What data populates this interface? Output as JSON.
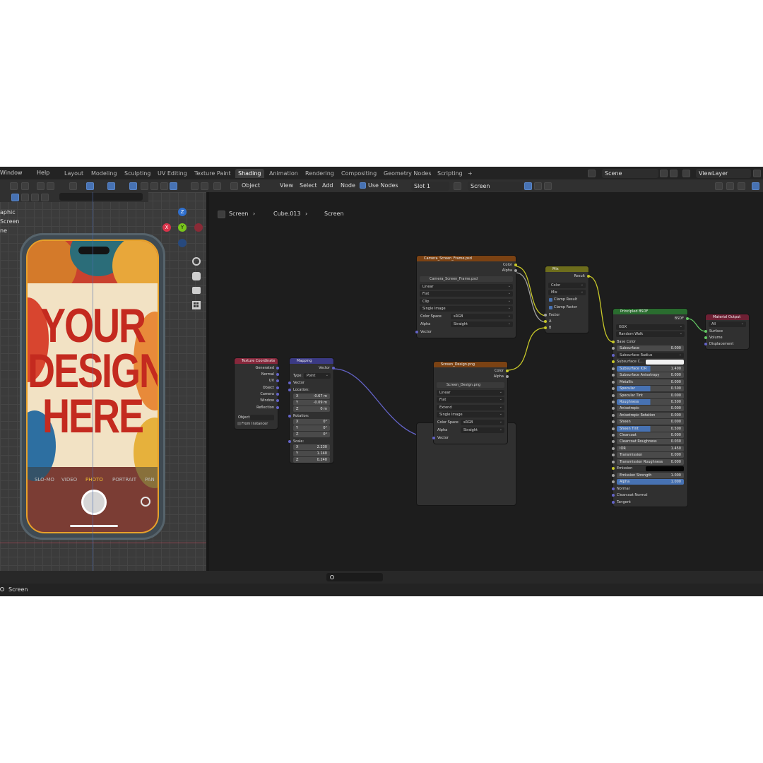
{
  "menubar": {
    "menus": [
      "Window",
      "Help"
    ],
    "workspaces": [
      "Layout",
      "Modeling",
      "Sculpting",
      "UV Editing",
      "Texture Paint",
      "Shading",
      "Animation",
      "Rendering",
      "Compositing",
      "Geometry Nodes",
      "Scripting"
    ],
    "add_tab": "+",
    "scene": "Scene",
    "view_layer": "ViewLayer"
  },
  "node_header": {
    "mode": "Object",
    "menus": [
      "View",
      "Select",
      "Add",
      "Node"
    ],
    "use_nodes": "Use Nodes",
    "slot": "Slot 1",
    "material": "Screen"
  },
  "breadcrumb": [
    "Screen",
    "Cube.013",
    "Screen"
  ],
  "outliner_fragment": [
    "aphic",
    "Screen",
    "ne"
  ],
  "viewport": {
    "axis": {
      "z": "Z",
      "x": "X",
      "y": "Y"
    },
    "design_text": [
      "YOUR",
      "DESIGN",
      "HERE"
    ],
    "camera_modes": [
      "SLO-MO",
      "VIDEO",
      "PHOTO",
      "PORTRAIT",
      "PAN"
    ]
  },
  "nodes": {
    "camera_frame": {
      "title": "Camera_Screen_Frame.psd",
      "outputs": [
        "Color",
        "Alpha"
      ],
      "image": "Camera_Screen_Frame.psd",
      "interp": "Linear",
      "proj": "Flat",
      "ext": "Clip",
      "source": "Single Image",
      "cs_label": "Color Space",
      "cs": "sRGB",
      "alpha_label": "Alpha",
      "alpha": "Straight",
      "input": "Vector"
    },
    "screen_design": {
      "title": "Screen_Design.png",
      "outputs": [
        "Color",
        "Alpha"
      ],
      "image": "Screen_Design.png",
      "interp": "Linear",
      "proj": "Flat",
      "ext": "Extend",
      "source": "Single Image",
      "cs_label": "Color Space",
      "cs": "sRGB",
      "alpha_label": "Alpha",
      "alpha": "Straight",
      "input": "Vector"
    },
    "mix": {
      "title": "Mix",
      "output": "Result",
      "type": "Color",
      "blend": "Mix",
      "clamp_result": "Clamp Result",
      "clamp_factor": "Clamp Factor",
      "inputs": [
        "Factor",
        "A",
        "B"
      ]
    },
    "texcoord": {
      "title": "Texture Coordinate",
      "outputs": [
        "Generated",
        "Normal",
        "UV",
        "Object",
        "Camera",
        "Window",
        "Reflection"
      ],
      "object_label": "Object:",
      "from_instancer": "From Instancer"
    },
    "mapping": {
      "title": "Mapping",
      "output": "Vector",
      "type_label": "Type:",
      "type": "Point",
      "input": "Vector",
      "location_label": "Location:",
      "location": [
        [
          "X",
          "-0.67 m"
        ],
        [
          "Y",
          "-0.09 m"
        ],
        [
          "Z",
          "0 m"
        ]
      ],
      "rotation_label": "Rotation:",
      "rotation": [
        [
          "X",
          "0°"
        ],
        [
          "Y",
          "0°"
        ],
        [
          "Z",
          "0°"
        ]
      ],
      "scale_label": "Scale:",
      "scale": [
        [
          "X",
          "2.230"
        ],
        [
          "Y",
          "1.140"
        ],
        [
          "Z",
          "0.240"
        ]
      ]
    },
    "bsdf": {
      "title": "Principled BSDF",
      "output": "BSDF",
      "distribution": "GGX",
      "sss_method": "Random Walk",
      "base_color": "Base Color",
      "subsurface": [
        "Subsurface",
        "0.000"
      ],
      "subsurface_radius": "Subsurface Radius",
      "subsurface_color": "Subsurface C...",
      "params": [
        [
          "Subsurface IOR",
          "1.400",
          "half"
        ],
        [
          "Subsurface Anisotropy",
          "0.000",
          "none"
        ],
        [
          "Metallic",
          "0.000",
          "none"
        ],
        [
          "Specular",
          "0.500",
          "half"
        ],
        [
          "Specular Tint",
          "0.000",
          "none"
        ],
        [
          "Roughness",
          "0.500",
          "half"
        ],
        [
          "Anisotropic",
          "0.000",
          "none"
        ],
        [
          "Anisotropic Rotation",
          "0.000",
          "none"
        ],
        [
          "Sheen",
          "0.000",
          "none"
        ],
        [
          "Sheen Tint",
          "0.500",
          "half"
        ],
        [
          "Clearcoat",
          "0.000",
          "none"
        ],
        [
          "Clearcoat Roughness",
          "0.030",
          "none"
        ],
        [
          "IOR",
          "1.450",
          "none"
        ],
        [
          "Transmission",
          "0.000",
          "none"
        ],
        [
          "Transmission Roughness",
          "0.000",
          "none"
        ]
      ],
      "emission": "Emission",
      "emission_strength": [
        "Emission Strength",
        "1.000"
      ],
      "alpha": [
        "Alpha",
        "1.000"
      ],
      "tail": [
        "Normal",
        "Clearcoat Normal",
        "Tangent"
      ]
    },
    "output": {
      "title": "Material Output",
      "target": "All",
      "inputs": [
        "Surface",
        "Volume",
        "Displacement"
      ]
    }
  },
  "status": {
    "label": "Screen"
  }
}
